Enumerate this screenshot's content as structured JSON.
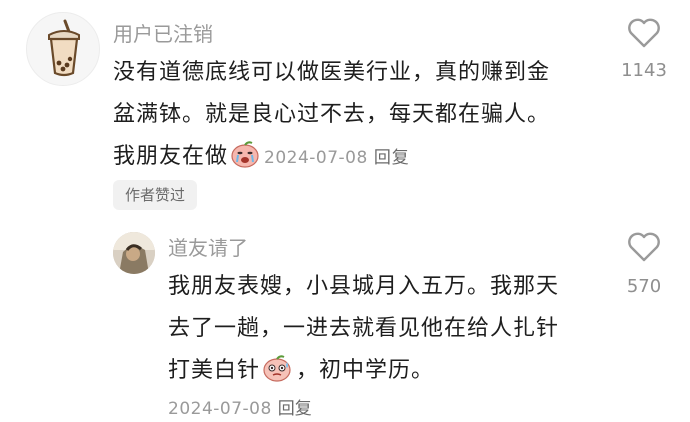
{
  "comments": [
    {
      "username": "用户已注销",
      "text_line1": "没有道德底线可以做医美行业，真的赚到金",
      "text_line2": "盆满钵。就是良心过不去，每天都在骗人。",
      "text_line3": "我朋友在做",
      "emoji_icon": "crying-peach-emoji",
      "date": "2024-07-08",
      "reply_label": "回复",
      "like_count": "1143",
      "badge": "作者赞过"
    },
    {
      "username": "道友请了",
      "text_line1": "我朋友表嫂，小县城月入五万。我那天",
      "text_line2": "去了一趟，一进去就看见他在给人扎针",
      "text_line3a": "打美白针",
      "emoji_icon": "sweating-peach-emoji",
      "text_line3b": "，初中学历。",
      "date": "2024-07-08",
      "reply_label": "回复",
      "like_count": "570"
    }
  ],
  "colors": {
    "username": "#9a9a9a",
    "body": "#1e1e1e",
    "badge_bg": "#f1f1f1",
    "heart_stroke": "#9a9a9a"
  }
}
